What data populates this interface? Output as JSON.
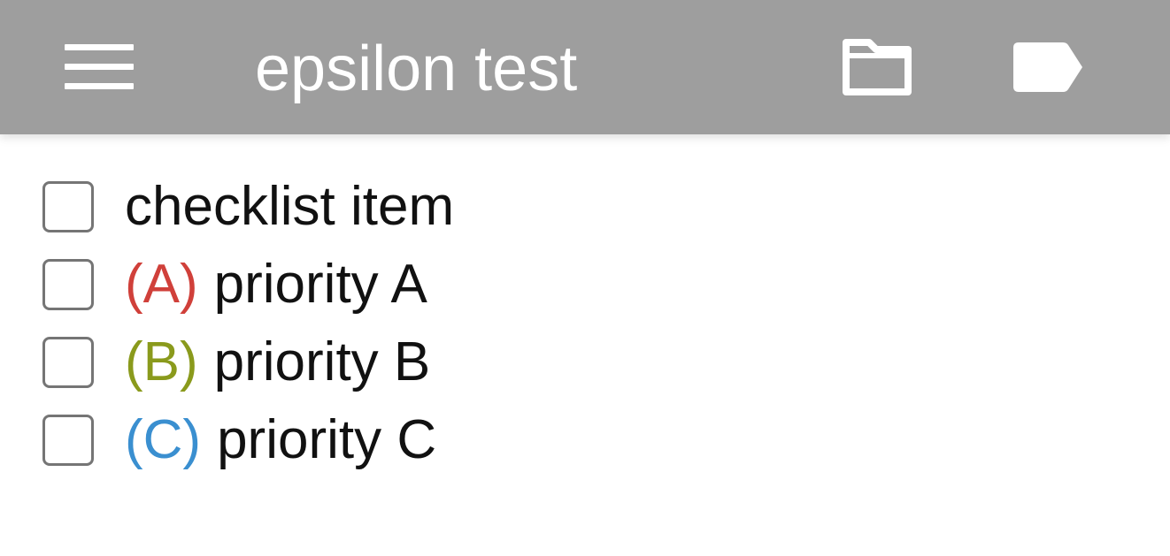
{
  "appbar": {
    "title": "epsilon test",
    "background": "#9e9e9e",
    "icons": {
      "menu": "menu-icon",
      "folder": "folder-icon",
      "tag": "tag-icon"
    }
  },
  "checklist": {
    "items": [
      {
        "priority": "",
        "priority_color": "",
        "label": "checklist item",
        "checked": false
      },
      {
        "priority": "(A)",
        "priority_color": "#d0403a",
        "label": "priority A",
        "checked": false
      },
      {
        "priority": "(B)",
        "priority_color": "#8a9a1c",
        "label": "priority B",
        "checked": false
      },
      {
        "priority": "(C)",
        "priority_color": "#3a8fd0",
        "label": "priority C",
        "checked": false
      }
    ]
  }
}
